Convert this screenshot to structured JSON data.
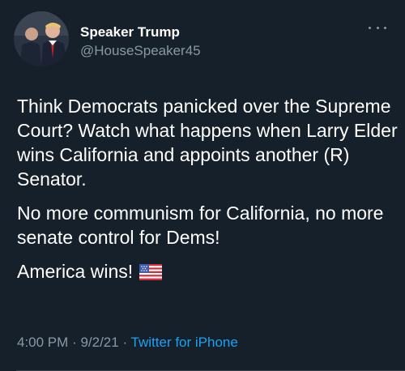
{
  "author": {
    "display_name": "Speaker Trump",
    "handle": "@HouseSpeaker45"
  },
  "tweet": {
    "paragraphs": [
      "Think Democrats panicked over the Supreme Court? Watch what happens when Larry Elder wins California and appoints another (R) Senator.",
      "No more communism for California, no more senate control for Dems!",
      "America wins!"
    ],
    "emoji": "us-flag-icon"
  },
  "meta": {
    "time": "4:00 PM",
    "separator": "·",
    "date": "9/2/21",
    "source": "Twitter for iPhone"
  },
  "colors": {
    "background": "#15202b",
    "secondary_text": "#8899a6",
    "link": "#1da1f2"
  }
}
